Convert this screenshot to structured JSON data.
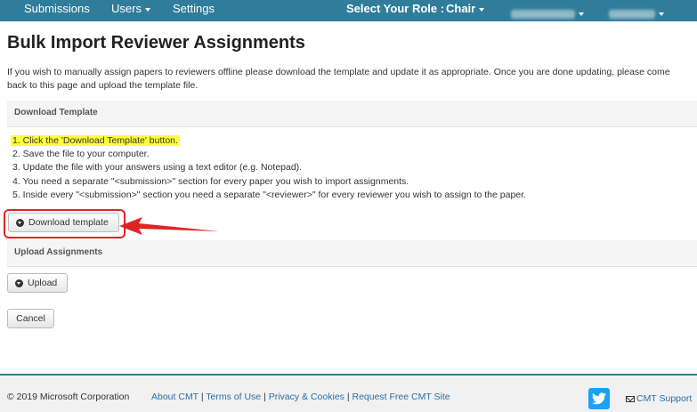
{
  "nav": {
    "submissions": "Submissions",
    "users": "Users",
    "settings": "Settings",
    "role_label": "Select Your Role :",
    "role_value": "Chair"
  },
  "page": {
    "title": "Bulk Import Reviewer Assignments",
    "intro": "If you wish to manually assign papers to reviewers offline please download the template and update it as appropriate. Once you are done updating, please come back to this page and upload the template file."
  },
  "download_section": {
    "header": "Download Template",
    "steps": [
      "1. Click the 'Download Template' button.",
      "2. Save the file to your computer.",
      "3. Update the file with your answers using a text editor (e.g. Notepad).",
      "4. You need a separate \"<submission>\" section for every paper you wish to import assignments.",
      "5. Inside every \"<submission>\" section you need a separate \"<reviewer>\" for every reviewer you wish to assign to the paper."
    ],
    "button": "Download template"
  },
  "upload_section": {
    "header": "Upload Assignments",
    "button": "Upload"
  },
  "cancel_button": "Cancel",
  "footer": {
    "copyright": "© 2019 Microsoft Corporation",
    "links": [
      "About CMT",
      "Terms of Use",
      "Privacy & Cookies",
      "Request Free CMT Site"
    ],
    "separator": " | ",
    "support": "CMT Support"
  },
  "colors": {
    "nav_bg": "#2f7d9b",
    "highlight": "#ffff3b",
    "callout": "#e02424",
    "link": "#2a6fa8"
  }
}
